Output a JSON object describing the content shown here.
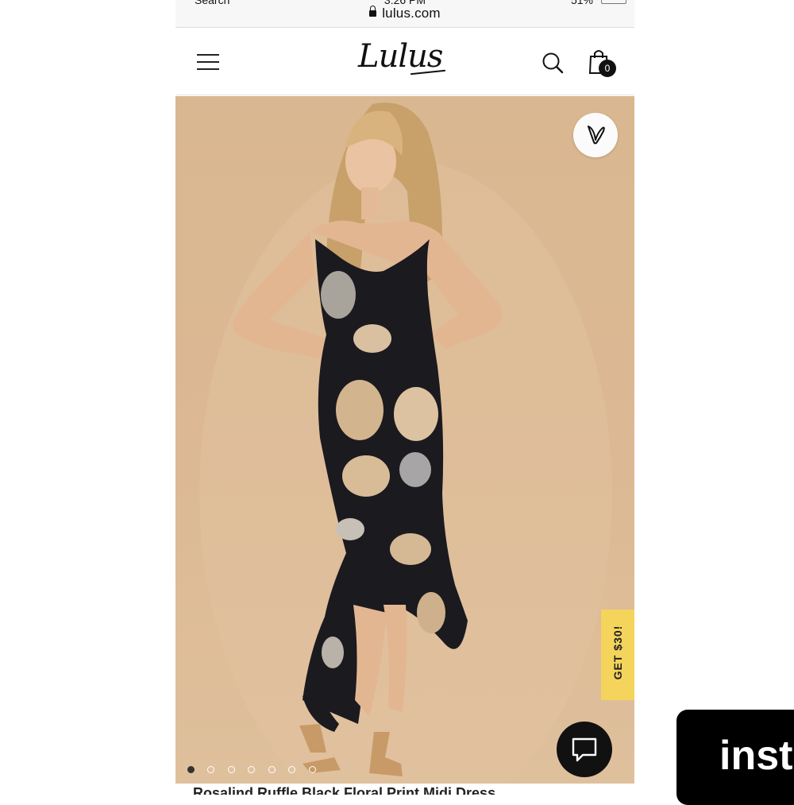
{
  "browser": {
    "carrier": "Search",
    "time": "3:26 PM",
    "battery": "51%",
    "url": "lulus.com"
  },
  "header": {
    "logo": "Lulus",
    "cart_count": "0"
  },
  "hero": {
    "promo_label": "GET $30!",
    "gallery_count": 7,
    "gallery_active_index": 0
  },
  "product": {
    "title": "Rosalind Ruffle Black Floral Print Midi Dress"
  },
  "watermark": {
    "text": "inst"
  },
  "colors": {
    "hero_background": "#d9b790",
    "promo_tab": "#f4d45b",
    "chat_button": "#111111",
    "dress": "#1b1a1f"
  },
  "icons": [
    "menu-icon",
    "search-icon",
    "shopping-bag-icon",
    "heart-icon",
    "chat-icon",
    "lock-icon"
  ]
}
